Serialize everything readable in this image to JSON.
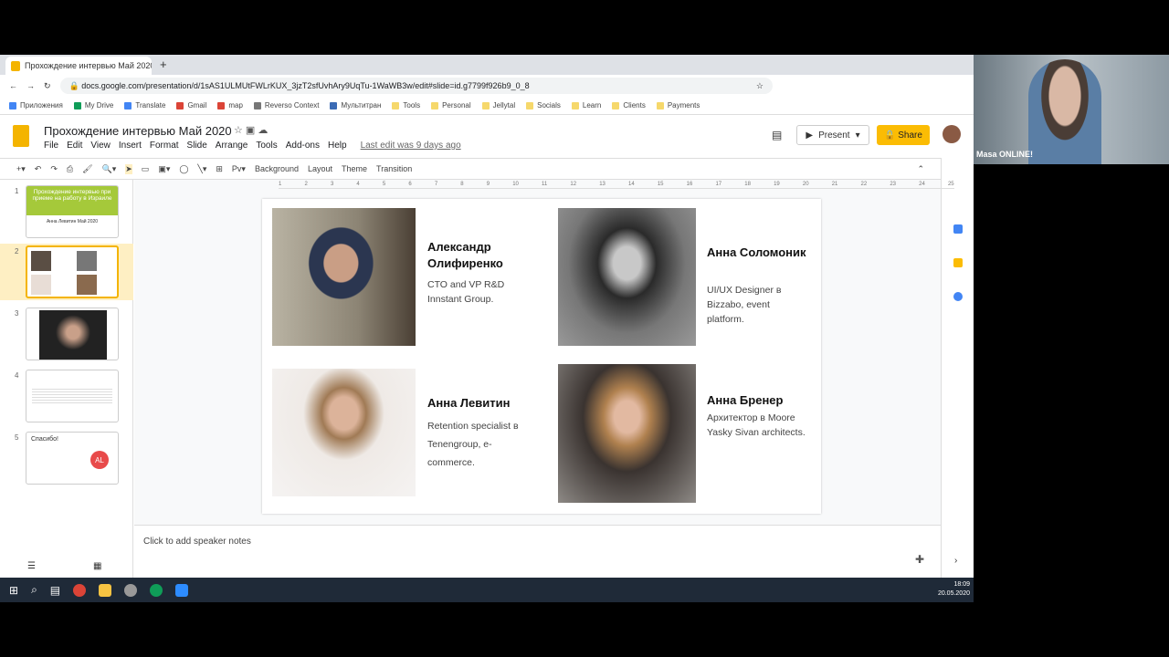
{
  "browser": {
    "tab_title": "Прохождение интервью Май 2020",
    "url": "docs.google.com/presentation/d/1sAS1ULMUtFWLrKUX_3jzT2sfUvhAry9UqTu-1WaWB3w/edit#slide=id.g7799f926b9_0_8",
    "bookmarks": [
      "Приложения",
      "My Drive",
      "Translate",
      "Gmail",
      "map",
      "Reverso Context",
      "Мультитран",
      "Tools",
      "Personal",
      "Jellytal",
      "Socials",
      "Learn",
      "Clients",
      "Payments"
    ]
  },
  "doc": {
    "title": "Прохождение интервью Май 2020",
    "menus": [
      "File",
      "Edit",
      "View",
      "Insert",
      "Format",
      "Slide",
      "Arrange",
      "Tools",
      "Add-ons",
      "Help"
    ],
    "last_edit": "Last edit was 9 days ago",
    "present": "Present",
    "share": "Share"
  },
  "toolbar": {
    "background": "Background",
    "layout": "Layout",
    "theme": "Theme",
    "transition": "Transition"
  },
  "ruler": [
    "1",
    "2",
    "3",
    "4",
    "5",
    "6",
    "7",
    "8",
    "9",
    "10",
    "11",
    "12",
    "13",
    "14",
    "15",
    "16",
    "17",
    "18",
    "19",
    "20",
    "21",
    "22",
    "23",
    "24",
    "25"
  ],
  "filmstrip": {
    "numbers": [
      "1",
      "2",
      "3",
      "4",
      "5"
    ],
    "slide1_title": "Прохождение интервью при приеме на работу в Израиле",
    "slide1_sub": "Анна Левитин Май 2020",
    "slide5_title": "Спасибо!",
    "slide5_badge": "AL"
  },
  "slide": {
    "people": [
      {
        "name": "Александр Олифиренко",
        "role": "CTO and VP R&D Innstant Group."
      },
      {
        "name": "Анна Соломоник",
        "role": "UI/UX Designer в Bizzabo, event platform."
      },
      {
        "name": "Анна Левитин",
        "role": "Retention specialist в Tenengroup, e-commerce."
      },
      {
        "name": "Анна Бренер",
        "role": "Архитектор в Moore Yasky Sivan architects."
      }
    ]
  },
  "notes": {
    "placeholder": "Click to add speaker notes"
  },
  "taskbar": {
    "time": "18:09",
    "date": "20.05.2020"
  },
  "webcam": {
    "name": "Masa ONLINE!"
  },
  "colors": {
    "accent": "#fbbc04",
    "slide1_green": "#a5c93a"
  }
}
